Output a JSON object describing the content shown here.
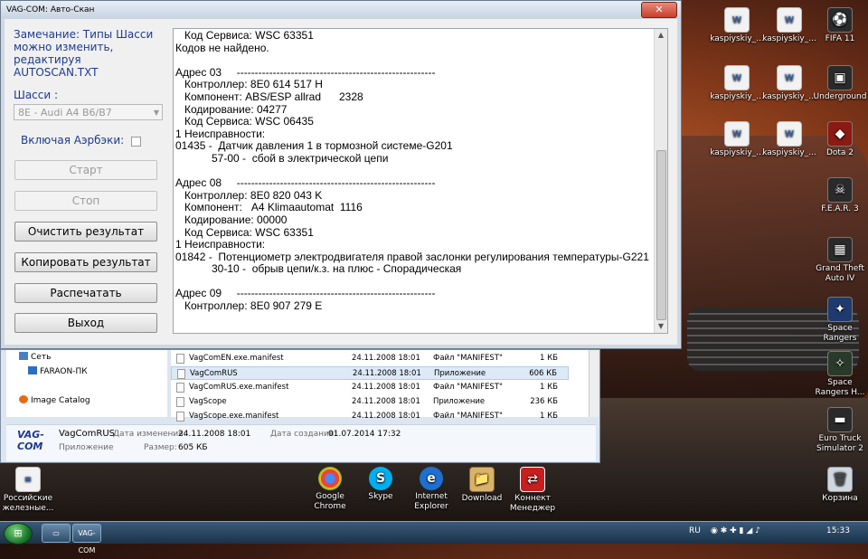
{
  "vag_window": {
    "title": "VAG-COM: Авто-Скан",
    "close": "✕",
    "note": "Замечание: Типы Шасси можно изменить, редактируя AUTOSCAN.TXT",
    "chassis_label": "Шасси :",
    "chassis_value": "8E - Audi A4 B6/B7",
    "airbag_label": "Включая Аэрбэки:",
    "buttons": {
      "start": "Старт",
      "stop": "Стоп",
      "clear": "Очистить результат",
      "copy": "Копировать результат",
      "print": "Распечатать",
      "exit": "Выход"
    },
    "output_lines": [
      "   Код Сервиса: WSC 63351",
      "Кодов не найдено.",
      "",
      "Адрес 03     -------------------------------------------------------",
      "   Контроллер: 8E0 614 517 H",
      "   Компонент: ABS/ESP allrad      2328",
      "   Кодирование: 04277",
      "   Код Сервиса: WSC 06435",
      "1 Неисправности:",
      "01435 -  Датчик давления 1 в тормозной системе-G201",
      "            57-00 -  сбой в электрической цепи",
      "",
      "Адрес 08     -------------------------------------------------------",
      "   Контроллер: 8E0 820 043 K",
      "   Компонент:   A4 Klimaautomat  1116",
      "   Кодирование: 00000",
      "   Код Сервиса: WSC 63351",
      "1 Неисправности:",
      "01842 -  Потенциометр электродвигателя правой заслонки регулирования температуры-G221",
      "            30-10 -  обрыв цепи/к.з. на плюс - Спорадическая",
      "",
      "Адрес 09     -------------------------------------------------------",
      "   Контроллер: 8E0 907 279 E"
    ]
  },
  "explorer": {
    "nav": [
      {
        "label": "Сеть"
      },
      {
        "label": "FARAON-ПК"
      },
      {
        "label": "Image Catalog"
      }
    ],
    "files": [
      {
        "name": "VagComEN.exe.manifest",
        "date": "24.11.2008 18:01",
        "type": "Файл \"MANIFEST\"",
        "size": "1 КБ"
      },
      {
        "name": "VagComRUS",
        "date": "24.11.2008 18:01",
        "type": "Приложение",
        "size": "606 КБ"
      },
      {
        "name": "VagComRUS.exe.manifest",
        "date": "24.11.2008 18:01",
        "type": "Файл \"MANIFEST\"",
        "size": "1 КБ"
      },
      {
        "name": "VagScope",
        "date": "24.11.2008 18:01",
        "type": "Приложение",
        "size": "236 КБ"
      },
      {
        "name": "VagScope.exe.manifest",
        "date": "24.11.2008 18:01",
        "type": "Файл \"MANIFEST\"",
        "size": "1 КБ"
      }
    ],
    "details": {
      "logo": "VAG-COM",
      "name": "VagComRUS",
      "modified_label": "Дата изменения:",
      "modified": "24.11.2008 18:01",
      "created_label": "Дата создания:",
      "created": "01.07.2014 17:32",
      "type": "Приложение",
      "size_label": "Размер:",
      "size": "605 КБ"
    }
  },
  "desktop_icons": {
    "k1": "kaspiyskiy_...",
    "k2": "kaspiyskiy_...",
    "k3": "kaspiyskiy_...",
    "k4": "kaspiyskiy_...",
    "k5": "kaspiyskiy_...",
    "k6": "kaspiyskiy_...",
    "fifa": "FIFA 11",
    "underground": "Underground",
    "dota": "Dota 2",
    "fear": "F.E.A.R. 3",
    "gta": "Grand Theft Auto IV",
    "space": "Space Rangers",
    "space_hd": "Space Rangers H...",
    "euro": "Euro Truck Simulator 2",
    "trash": "Корзина",
    "chrome": "Google Chrome",
    "skype": "Skype",
    "ie": "Internet Explorer",
    "download": "Download",
    "konnekt": "Коннект Менеджер",
    "rzd": "Российские железные..."
  },
  "taskbar": {
    "vag_btn": "VAG-COM",
    "lang": "RU",
    "time": "15:33"
  }
}
